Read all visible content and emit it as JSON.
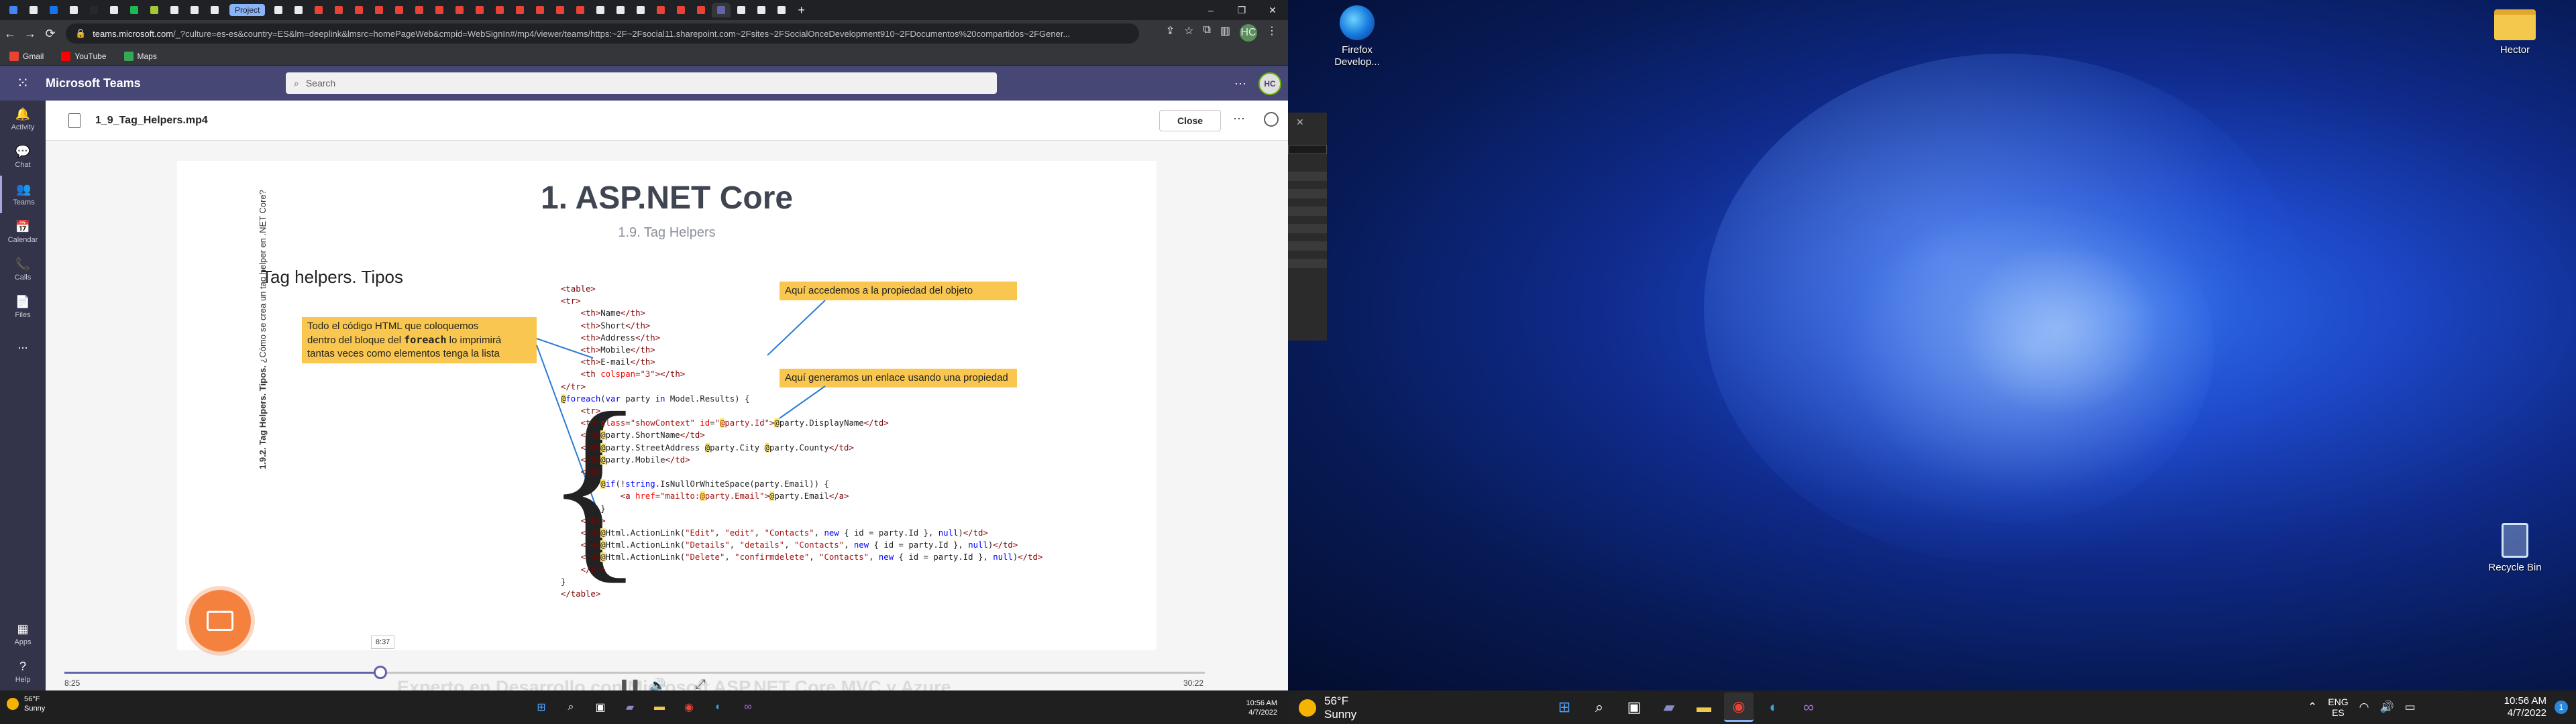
{
  "browser": {
    "active_tab_label": "Project",
    "new_tab": "+",
    "window_controls": [
      "–",
      "❐",
      "✕"
    ],
    "url_domain": "teams.microsoft.com",
    "url_rest": "/_?culture=es-es&country=ES&lm=deeplink&lmsrc=homePageWeb&cmpid=WebSignIn#/mp4/viewer/teams/https:~2F~2Fsocial11.sharepoint.com~2Fsites~2FSocialOnceDevelopment910~2FDocumentos%20compartidos~2FGener...",
    "profile_initials": "HC",
    "bookmarks": [
      "Gmail",
      "YouTube",
      "Maps"
    ]
  },
  "teams": {
    "app_title": "Microsoft Teams",
    "search_placeholder": "Search",
    "user_initials": "HC",
    "rail": {
      "activity": "Activity",
      "chat": "Chat",
      "teams": "Teams",
      "calendar": "Calendar",
      "calls": "Calls",
      "files": "Files",
      "more": "...",
      "apps": "Apps",
      "help": "Help"
    }
  },
  "viewer": {
    "file_name": "1_9_Tag_Helpers.mp4",
    "close_label": "Close",
    "more": "···",
    "current_time": "8:25",
    "total_time": "30:22",
    "hover_time": "8:37",
    "progress_fraction": 0.277,
    "watermark": "Experto en Desarrollo con Microsoft ASP.NET Core MVC y Azure"
  },
  "slide": {
    "title": "1. ASP.NET Core",
    "subtitle": "1.9. Tag Helpers",
    "heading": "Tag helpers. Tipos",
    "vertical_bold": "1.9.2. Tag Helpers. Tipos.",
    "vertical_rest": " ¿Cómo se crea un tag helper en .NET Core?",
    "note_foreach": [
      "Todo el código HTML que coloquemos",
      "dentro del bloque del ",
      "foreach",
      " lo imprimirá",
      "tantas veces como elementos tenga la lista"
    ],
    "note_property": "Aquí accedemos a la propiedad del objeto",
    "note_link": "Aquí generamos un enlace usando una propiedad"
  },
  "taskbar_left": {
    "temp": "56°F",
    "weather": "Sunny",
    "time": "10:56 AM",
    "date": "4/7/2022"
  },
  "desktop": {
    "icons": {
      "firefox": "Firefox Develop...",
      "hector": "Hector",
      "recycle": "Recycle Bin"
    },
    "taskbar": {
      "temp": "56°F",
      "weather": "Sunny",
      "lang_top": "ENG",
      "lang_bottom": "ES",
      "time": "10:56 AM",
      "date": "4/7/2022",
      "notifications": "1"
    }
  },
  "colors": {
    "teams_purple": "#464775",
    "teams_rail": "#33344a",
    "note_yellow": "#f9c74f",
    "accent": "#6264a7"
  }
}
